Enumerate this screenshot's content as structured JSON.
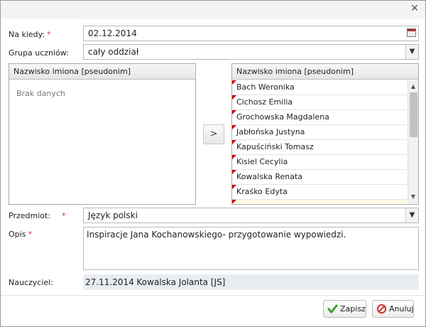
{
  "form": {
    "date_label": "Na kiedy:",
    "date_value": "02.12.2014",
    "group_label": "Grupa uczniów:",
    "group_value": "cały oddział",
    "subject_label": "Przedmiot:",
    "subject_value": "Język polski",
    "description_label": "Opis",
    "description_value": "Inspiracje Jana Kochanowskiego- przygotowanie wypowiedzi.",
    "teacher_label": "Nauczyciel:",
    "teacher_value": "27.11.2014 Kowalska Jolanta [JS]",
    "required_mark": "*"
  },
  "left_panel": {
    "header": "Nazwisko imiona [pseudonim]",
    "empty_text": "Brak danych"
  },
  "right_panel": {
    "header": "Nazwisko imiona [pseudonim]",
    "students": [
      "Bach Weronika",
      "Cichosz Emilia",
      "Grochowska Magdalena",
      "Jabłońska Justyna",
      "Kapuściński Tomasz",
      "Kisiel Cecylia",
      "Kowalska Renata",
      "Kraśko Edyta"
    ]
  },
  "move_button": ">",
  "buttons": {
    "save": "Zapisz",
    "cancel": "Anuluj"
  },
  "icons": {
    "close": "close-icon",
    "calendar": "calendar-icon",
    "dropdown": "chevron-down-icon",
    "save": "checkmark-icon",
    "cancel": "cancel-icon"
  },
  "colors": {
    "required": "#d9312b",
    "flag": "#cc0000",
    "readonly_bg": "#e9edf2"
  }
}
